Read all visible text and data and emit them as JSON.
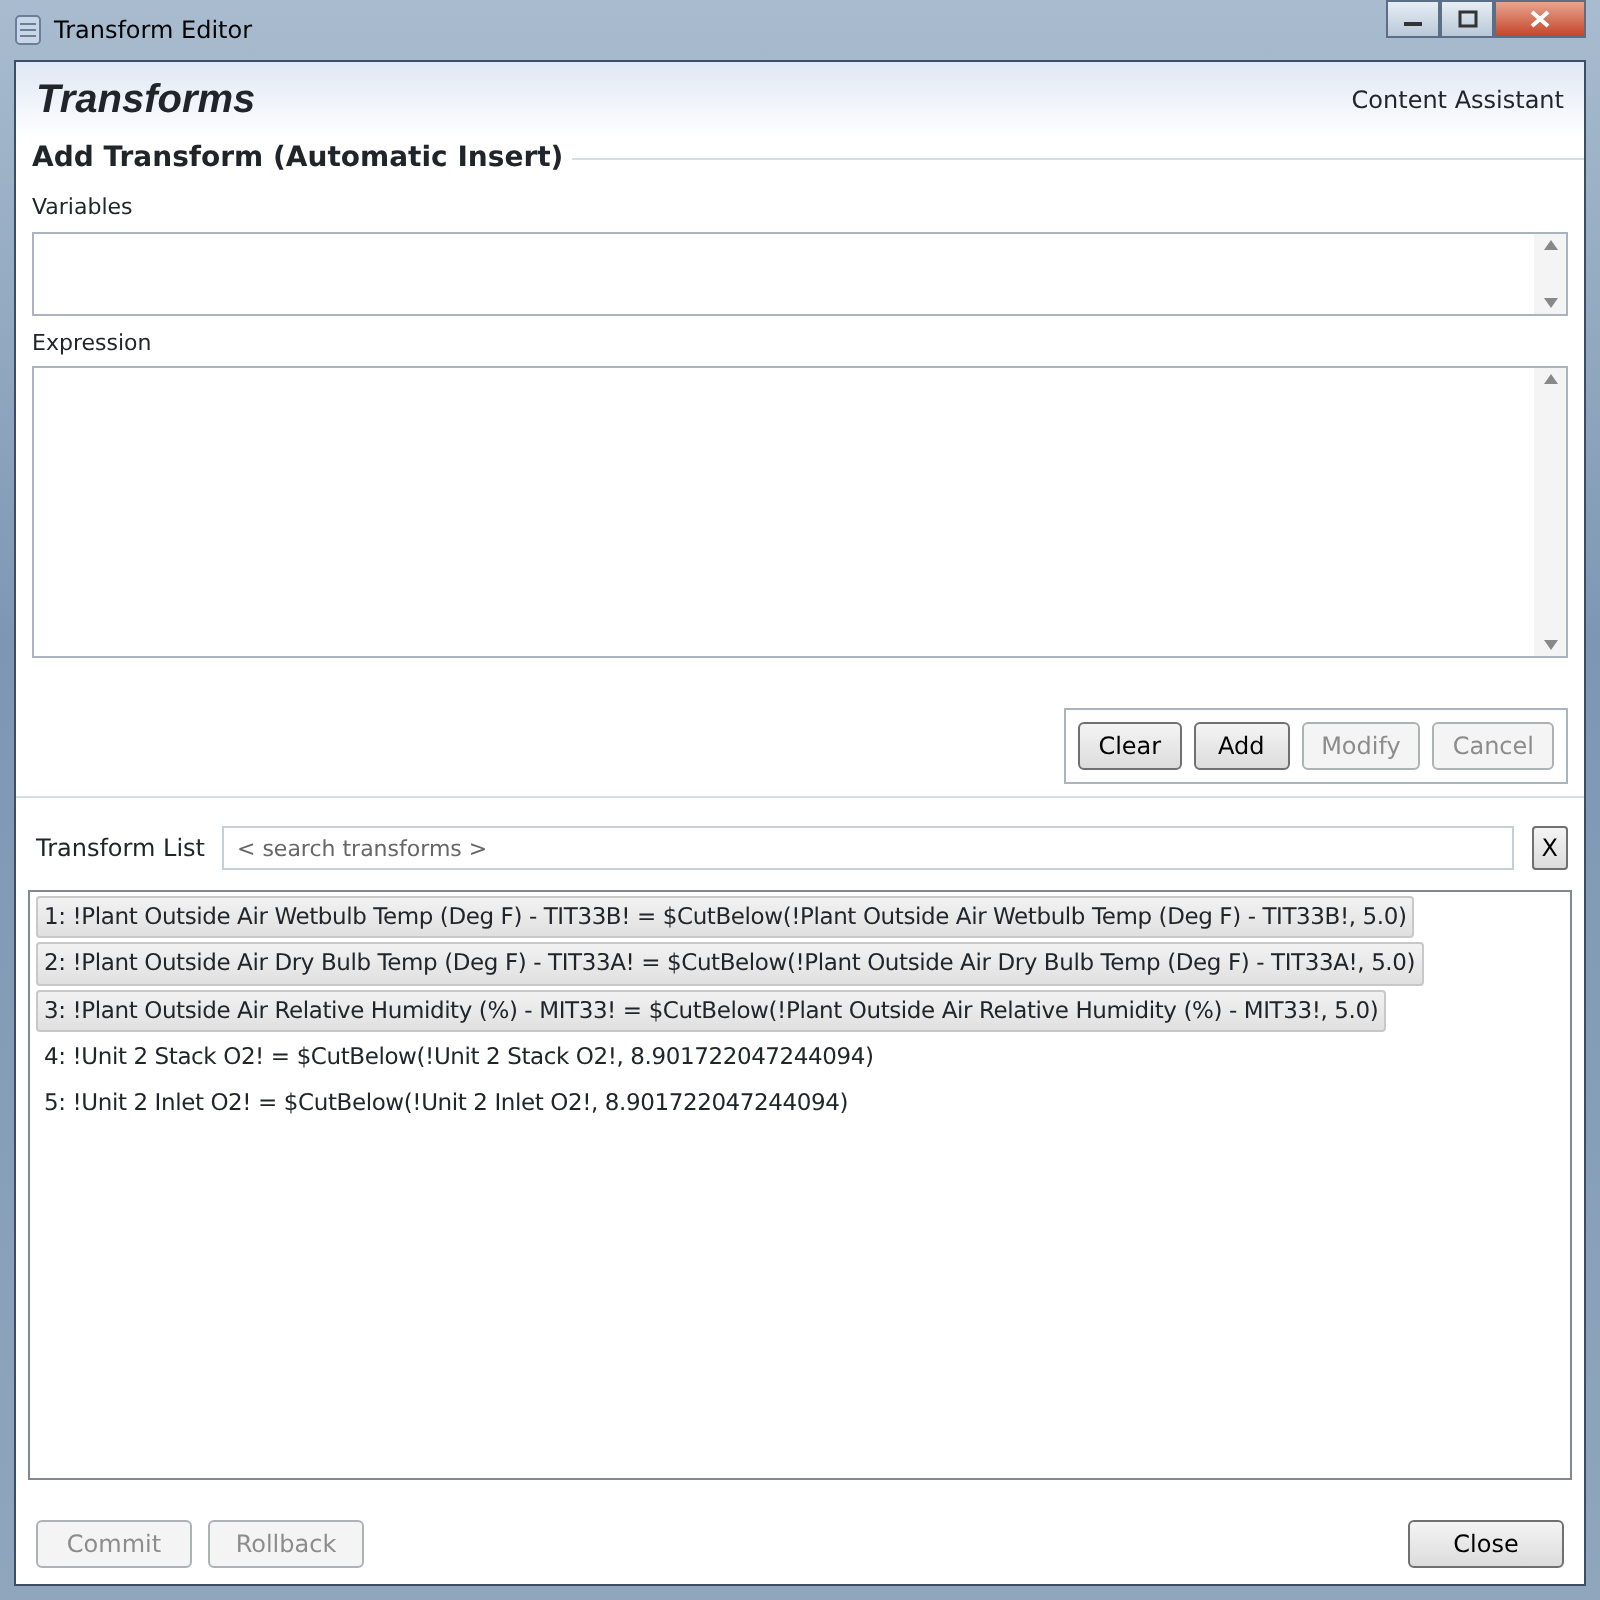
{
  "window": {
    "title": "Transform Editor"
  },
  "header": {
    "title": "Transforms",
    "link": "Content Assistant"
  },
  "section": {
    "title": "Add Transform (Automatic Insert)"
  },
  "fields": [
    {
      "label": "Variables"
    },
    {
      "label": "Expression"
    }
  ],
  "edit_buttons": [
    {
      "label": "Clear",
      "disabled": false
    },
    {
      "label": "Add",
      "disabled": false
    },
    {
      "label": "Modify",
      "disabled": true
    },
    {
      "label": "Cancel",
      "disabled": true
    }
  ],
  "transform_list": {
    "label": "Transform List",
    "placeholder": "< search transforms >",
    "clear_button": "X",
    "items": [
      {
        "text": "1: !Plant Outside Air Wetbulb Temp (Deg F) - TIT33B! = $CutBelow(!Plant Outside Air Wetbulb Temp (Deg F) - TIT33B!, 5.0)",
        "selected": true
      },
      {
        "text": "2: !Plant Outside Air Dry Bulb Temp (Deg F) - TIT33A! = $CutBelow(!Plant Outside Air Dry Bulb Temp (Deg F) - TIT33A!, 5.0)",
        "selected": true
      },
      {
        "text": "3: !Plant Outside Air Relative Humidity (%) - MIT33! = $CutBelow(!Plant Outside Air Relative Humidity (%) - MIT33!, 5.0)",
        "selected": true
      },
      {
        "text": "4: !Unit 2 Stack O2! = $CutBelow(!Unit 2 Stack O2!, 8.901722047244094)",
        "selected": false
      },
      {
        "text": "5: !Unit 2 Inlet O2! = $CutBelow(!Unit 2 Inlet O2!, 8.901722047244094)",
        "selected": false
      }
    ]
  },
  "footer_buttons": [
    {
      "label": "Commit",
      "disabled": true
    },
    {
      "label": "Rollback",
      "disabled": true
    },
    {
      "label": "Close",
      "disabled": false
    }
  ]
}
